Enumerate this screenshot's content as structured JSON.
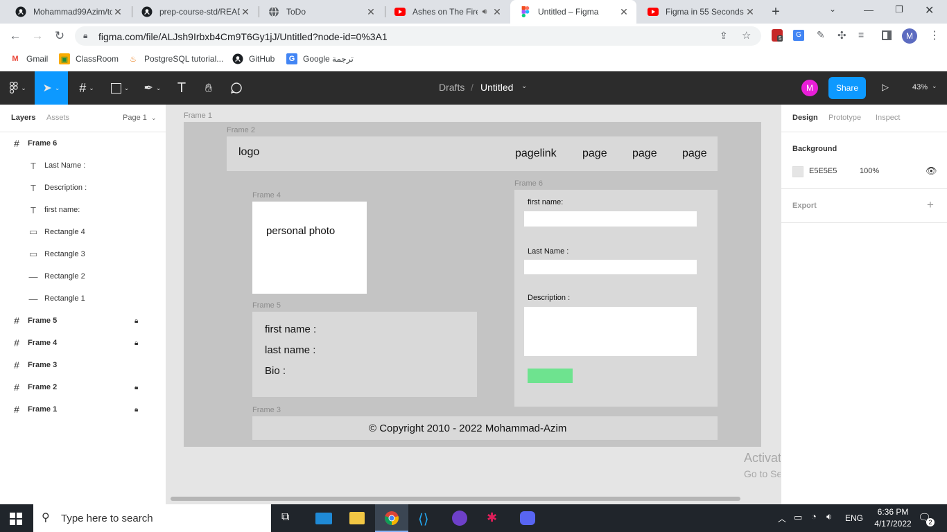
{
  "browser": {
    "tabs": [
      {
        "title": "Mohammad99Azim/to",
        "icon": "github-icon",
        "active": false
      },
      {
        "title": "prep-course-std/READ",
        "icon": "github-icon",
        "active": false
      },
      {
        "title": "ToDo",
        "icon": "globe-icon",
        "active": false
      },
      {
        "title": "Ashes on The Fire",
        "icon": "youtube-icon",
        "active": false
      },
      {
        "title": "Untitled – Figma",
        "icon": "figma-icon",
        "active": true
      },
      {
        "title": "Figma in 55 Seconds",
        "icon": "youtube-icon",
        "active": false
      }
    ],
    "url": "figma.com/file/ALJsh9Irbxb4Cm9T6Gy1jJ/Untitled?node-id=0%3A1",
    "extension_badge": "5",
    "profile_initial": "M",
    "bookmarks": [
      {
        "label": "Gmail",
        "icon": "gmail-icon"
      },
      {
        "label": "ClassRoom",
        "icon": "classroom-icon"
      },
      {
        "label": "PostgreSQL tutorial...",
        "icon": "java-icon"
      },
      {
        "label": "GitHub",
        "icon": "github-icon"
      },
      {
        "label": "Google ترجمة",
        "icon": "translate-icon"
      }
    ]
  },
  "figma": {
    "breadcrumb_parent": "Drafts",
    "breadcrumb_sep": "/",
    "file_name": "Untitled",
    "avatar_initial": "M",
    "share_label": "Share",
    "zoom": "43%",
    "avatar_color": "#e91ed8",
    "accent": "#0d99ff"
  },
  "left_panel": {
    "tabs": {
      "layers": "Layers",
      "assets": "Assets"
    },
    "page": "Page 1",
    "layers": [
      {
        "name": "Frame 6",
        "icon": "frame-icon",
        "bold": true,
        "locked": false,
        "indent": false
      },
      {
        "name": "Last Name :",
        "icon": "text-icon",
        "bold": false,
        "locked": false,
        "indent": true
      },
      {
        "name": "Description :",
        "icon": "text-icon",
        "bold": false,
        "locked": false,
        "indent": true
      },
      {
        "name": "first name:",
        "icon": "text-icon",
        "bold": false,
        "locked": false,
        "indent": true
      },
      {
        "name": "Rectangle 4",
        "icon": "rectangle-icon",
        "bold": false,
        "locked": false,
        "indent": true
      },
      {
        "name": "Rectangle 3",
        "icon": "rectangle-icon",
        "bold": false,
        "locked": false,
        "indent": true
      },
      {
        "name": "Rectangle 2",
        "icon": "line-icon",
        "bold": false,
        "locked": false,
        "indent": true
      },
      {
        "name": "Rectangle 1",
        "icon": "line-icon",
        "bold": false,
        "locked": false,
        "indent": true
      },
      {
        "name": "Frame 5",
        "icon": "frame-icon",
        "bold": true,
        "locked": true,
        "indent": false
      },
      {
        "name": "Frame 4",
        "icon": "frame-icon",
        "bold": true,
        "locked": true,
        "indent": false
      },
      {
        "name": "Frame 3",
        "icon": "frame-icon",
        "bold": true,
        "locked": false,
        "indent": false
      },
      {
        "name": "Frame 2",
        "icon": "frame-icon",
        "bold": true,
        "locked": true,
        "indent": false
      },
      {
        "name": "Frame 1",
        "icon": "frame-icon",
        "bold": true,
        "locked": true,
        "indent": false
      }
    ]
  },
  "canvas": {
    "frame1_label": "Frame 1",
    "frame2_label": "Frame 2",
    "frame3_label": "Frame 3",
    "frame4_label": "Frame 4",
    "frame5_label": "Frame 5",
    "frame6_label": "Frame 6",
    "nav_logo": "logo",
    "nav_links": [
      "pagelink",
      "page",
      "page",
      "page"
    ],
    "photo_text": "personal photo",
    "info_lines": [
      "first name :",
      "last name :",
      "Bio :"
    ],
    "form_first": "first name:",
    "form_last": "Last Name :",
    "form_desc": "Description :",
    "footer_text": "© Copyright 2010 - 2022 Mohammad-Azim",
    "button_color": "#6ee38f",
    "watermark_title": "Activate Windows",
    "watermark_sub": "Go to Settings to activate Windows.",
    "help_label": "?"
  },
  "right_panel": {
    "tabs": {
      "design": "Design",
      "prototype": "Prototype",
      "inspect": "Inspect"
    },
    "background_heading": "Background",
    "bg_hex": "E5E5E5",
    "bg_opacity": "100%",
    "bg_color": "#e5e5e5",
    "export_heading": "Export"
  },
  "taskbar": {
    "search_placeholder": "Type here to search",
    "language": "ENG",
    "time": "6:36 PM",
    "date": "4/17/2022",
    "notification_count": "2"
  }
}
